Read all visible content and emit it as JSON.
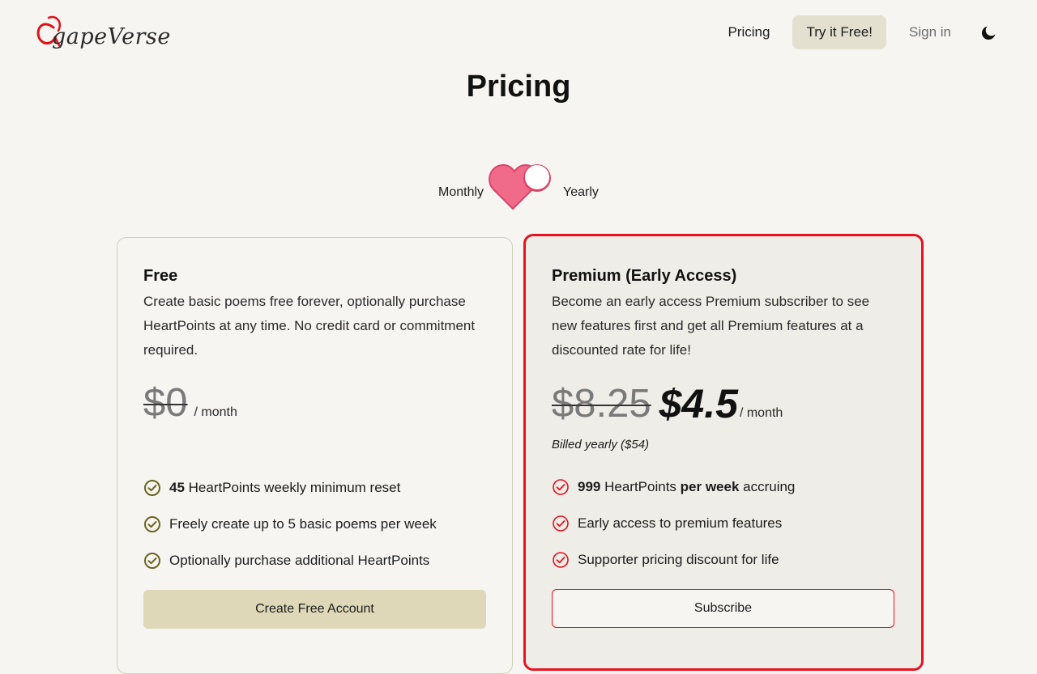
{
  "brand": {
    "logo_text": "gapeVerse"
  },
  "nav": {
    "pricing": "Pricing",
    "try_free": "Try it Free!",
    "sign_in": "Sign in",
    "theme_icon": "moon-icon"
  },
  "page": {
    "title": "Pricing"
  },
  "billing_toggle": {
    "monthly_label": "Monthly",
    "yearly_label": "Yearly",
    "selected": "Yearly",
    "icon": "heart-toggle-icon"
  },
  "plans": [
    {
      "name": "Free",
      "description": "Create basic poems free forever, optionally purchase HeartPoints at any time. No credit card or commitment required.",
      "old_price": "$0",
      "period": "/ month",
      "features": [
        {
          "bold": "45",
          "text": " HeartPoints weekly minimum reset"
        },
        {
          "text": "Freely create up to 5 basic poems per week"
        },
        {
          "text": "Optionally purchase additional HeartPoints"
        }
      ],
      "cta": "Create Free Account",
      "accent": "#6b6420"
    },
    {
      "name": "Premium (Early Access)",
      "description": "Become an early access Premium subscriber to see new features first and get all Premium features at a discounted rate for life!",
      "old_price": "$8.25",
      "price": "$4.5",
      "period": "/ month",
      "billed": "Billed yearly ($54)",
      "features": [
        {
          "bold": "999",
          "text_a": " HeartPoints ",
          "bold_b": "per week",
          "text_b": " accruing"
        },
        {
          "text": "Early access to premium features"
        },
        {
          "text": "Supporter pricing discount for life"
        }
      ],
      "cta": "Subscribe",
      "accent": "#e8121e"
    }
  ],
  "colors": {
    "background": "#f6f5f1",
    "highlight_border": "#e8121e",
    "free_button": "#ded8b8",
    "heart": "#f06a8a"
  }
}
